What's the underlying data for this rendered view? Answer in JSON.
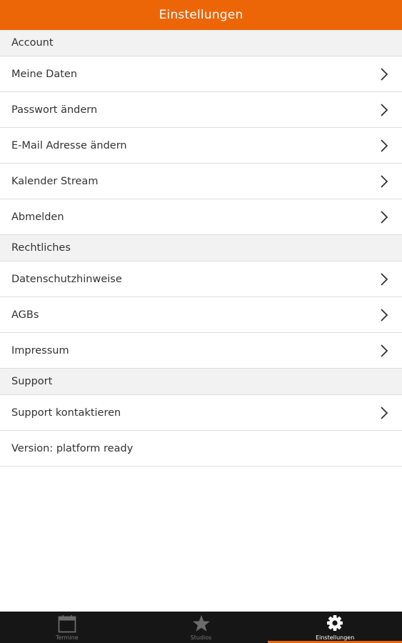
{
  "header": {
    "title": "Einstellungen"
  },
  "sections": {
    "account": {
      "title": "Account",
      "items": [
        "Meine Daten",
        "Passwort ändern",
        "E-Mail Adresse ändern",
        "Kalender Stream",
        "Abmelden"
      ]
    },
    "legal": {
      "title": "Rechtliches",
      "items": [
        "Datenschutzhinweise",
        "AGBs",
        "Impressum"
      ]
    },
    "support": {
      "title": "Support",
      "items": [
        "Support kontaktieren"
      ],
      "version": "Version: platform ready"
    }
  },
  "tabbar": {
    "tabs": [
      {
        "label": "Termine",
        "icon": "calendar-icon"
      },
      {
        "label": "Studios",
        "icon": "star-icon"
      },
      {
        "label": "Einstellungen",
        "icon": "gear-icon",
        "active": true
      }
    ]
  },
  "colors": {
    "accent": "#ec6608",
    "tabbar_background": "#161616",
    "section_background": "#f2f2f2"
  }
}
